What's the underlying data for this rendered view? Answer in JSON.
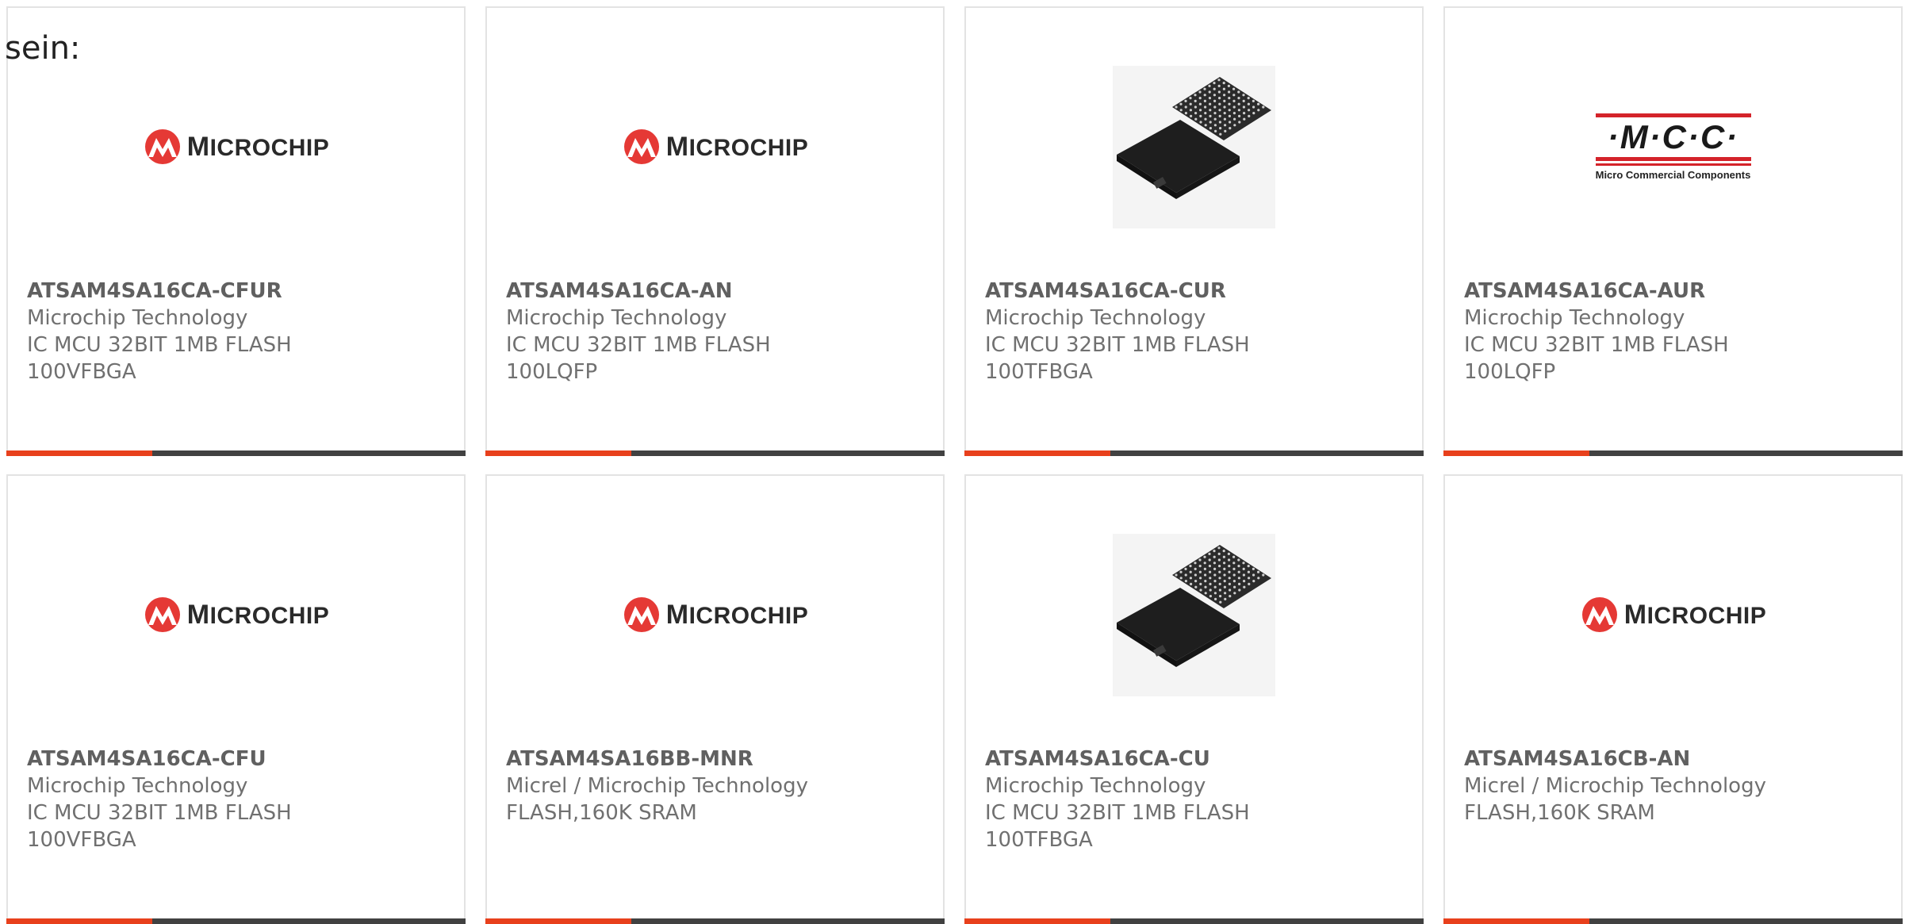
{
  "intro_text": "sein:",
  "colors": {
    "accent": "#e8401c",
    "bar": "#414141",
    "microchip_red": "#e53935",
    "mcc_red": "#d4232a"
  },
  "microchip_logo": {
    "first": "M",
    "rest": "ICROCHIP"
  },
  "mcc_logo": {
    "word": "·M·C·C·",
    "subtitle": "Micro Commercial Components"
  },
  "products": [
    {
      "part": "ATSAM4SA16CA-CFUR",
      "manufacturer": "Microchip Technology",
      "desc_line1": "IC MCU 32BIT 1MB FLASH",
      "desc_line2": "100VFBGA",
      "image": "microchip-logo"
    },
    {
      "part": "ATSAM4SA16CA-AN",
      "manufacturer": "Microchip Technology",
      "desc_line1": "IC MCU 32BIT 1MB FLASH",
      "desc_line2": "100LQFP",
      "image": "microchip-logo"
    },
    {
      "part": "ATSAM4SA16CA-CUR",
      "manufacturer": "Microchip Technology",
      "desc_line1": "IC MCU 32BIT 1MB FLASH",
      "desc_line2": "100TFBGA",
      "image": "bga-chip-photo"
    },
    {
      "part": "ATSAM4SA16CA-AUR",
      "manufacturer": "Microchip Technology",
      "desc_line1": "IC MCU 32BIT 1MB FLASH",
      "desc_line2": "100LQFP",
      "image": "mcc-logo"
    },
    {
      "part": "ATSAM4SA16CA-CFU",
      "manufacturer": "Microchip Technology",
      "desc_line1": "IC MCU 32BIT 1MB FLASH",
      "desc_line2": "100VFBGA",
      "image": "microchip-logo"
    },
    {
      "part": "ATSAM4SA16BB-MNR",
      "manufacturer": "Micrel / Microchip Technology",
      "desc_line1": "FLASH,160K SRAM",
      "desc_line2": "",
      "image": "microchip-logo"
    },
    {
      "part": "ATSAM4SA16CA-CU",
      "manufacturer": "Microchip Technology",
      "desc_line1": "IC MCU 32BIT 1MB FLASH",
      "desc_line2": "100TFBGA",
      "image": "bga-chip-photo"
    },
    {
      "part": "ATSAM4SA16CB-AN",
      "manufacturer": "Micrel / Microchip Technology",
      "desc_line1": "FLASH,160K SRAM",
      "desc_line2": "",
      "image": "microchip-logo"
    }
  ]
}
